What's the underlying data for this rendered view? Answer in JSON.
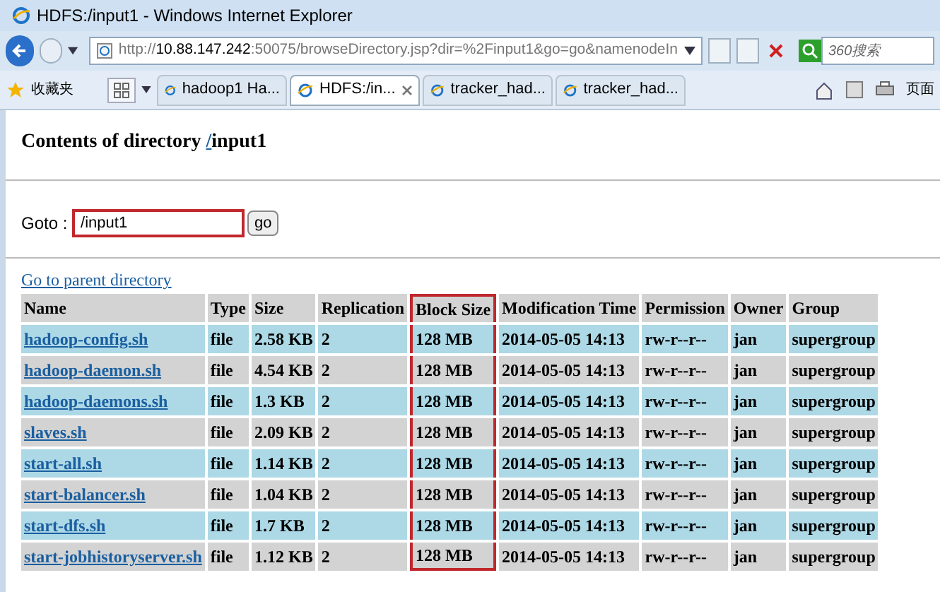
{
  "window": {
    "title": "HDFS:/input1 - Windows Internet Explorer"
  },
  "address_bar": {
    "url_prefix": "http://",
    "url_host": "10.88.147.242",
    "url_rest": ":50075/browseDirectory.jsp?dir=%2Finput1&go=go&namenodeIn"
  },
  "search": {
    "placeholder": "360搜索"
  },
  "favorites": {
    "label": "收藏夹"
  },
  "tabs": [
    {
      "label": "hadoop1 Ha...",
      "selected": false
    },
    {
      "label": "HDFS:/in...",
      "selected": true
    },
    {
      "label": "tracker_had...",
      "selected": false
    },
    {
      "label": "tracker_had...",
      "selected": false
    }
  ],
  "toolbar_right": {
    "label": "页面"
  },
  "page": {
    "heading": "Contents of directory ",
    "heading_root": "/",
    "heading_dir": "input1",
    "goto_label": "Goto : ",
    "goto_value": "/input1",
    "goto_highlighted": true,
    "go_button": "go",
    "parent_link": "Go to parent directory"
  },
  "table": {
    "columns": [
      {
        "label": "Name",
        "highlighted": false
      },
      {
        "label": "Type",
        "highlighted": false
      },
      {
        "label": "Size",
        "highlighted": false
      },
      {
        "label": "Replication",
        "highlighted": false
      },
      {
        "label": "Block Size",
        "highlighted": true
      },
      {
        "label": "Modification Time",
        "highlighted": false
      },
      {
        "label": "Permission",
        "highlighted": false
      },
      {
        "label": "Owner",
        "highlighted": false
      },
      {
        "label": "Group",
        "highlighted": false
      }
    ],
    "rows": [
      [
        "hadoop-config.sh",
        "file",
        "2.58 KB",
        "2",
        "128 MB",
        "2014-05-05 14:13",
        "rw-r--r--",
        "jan",
        "supergroup"
      ],
      [
        "hadoop-daemon.sh",
        "file",
        "4.54 KB",
        "2",
        "128 MB",
        "2014-05-05 14:13",
        "rw-r--r--",
        "jan",
        "supergroup"
      ],
      [
        "hadoop-daemons.sh",
        "file",
        "1.3 KB",
        "2",
        "128 MB",
        "2014-05-05 14:13",
        "rw-r--r--",
        "jan",
        "supergroup"
      ],
      [
        "slaves.sh",
        "file",
        "2.09 KB",
        "2",
        "128 MB",
        "2014-05-05 14:13",
        "rw-r--r--",
        "jan",
        "supergroup"
      ],
      [
        "start-all.sh",
        "file",
        "1.14 KB",
        "2",
        "128 MB",
        "2014-05-05 14:13",
        "rw-r--r--",
        "jan",
        "supergroup"
      ],
      [
        "start-balancer.sh",
        "file",
        "1.04 KB",
        "2",
        "128 MB",
        "2014-05-05 14:13",
        "rw-r--r--",
        "jan",
        "supergroup"
      ],
      [
        "start-dfs.sh",
        "file",
        "1.7 KB",
        "2",
        "128 MB",
        "2014-05-05 14:13",
        "rw-r--r--",
        "jan",
        "supergroup"
      ],
      [
        "start-jobhistoryserver.sh",
        "file",
        "1.12 KB",
        "2",
        "128 MB",
        "2014-05-05 14:13",
        "rw-r--r--",
        "jan",
        "supergroup"
      ]
    ]
  }
}
